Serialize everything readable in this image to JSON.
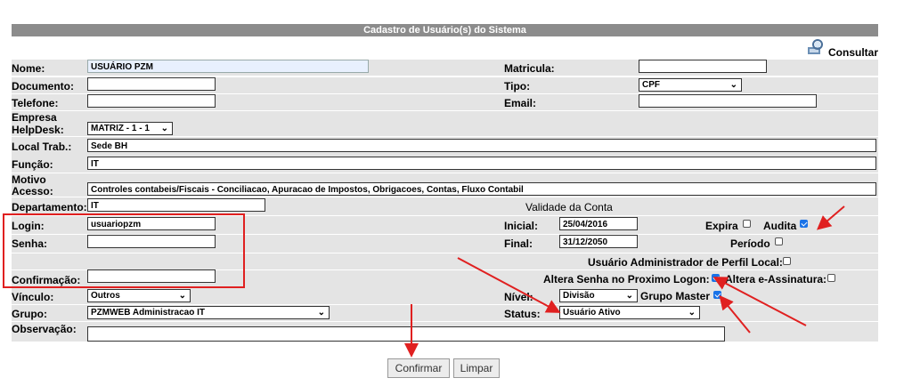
{
  "header": {
    "title": "Cadastro de Usuário(s) do Sistema",
    "consultar_label": "Consultar"
  },
  "fields": {
    "nome": {
      "label": "Nome:",
      "value": "USUÁRIO PZM"
    },
    "matricula": {
      "label": "Matricula:",
      "value": ""
    },
    "documento": {
      "label": "Documento:",
      "value": ""
    },
    "tipo": {
      "label": "Tipo:",
      "value": "CPF"
    },
    "telefone": {
      "label": "Telefone:",
      "value": ""
    },
    "email": {
      "label": "Email:",
      "value": ""
    },
    "empresa": {
      "label_line1": "Empresa",
      "label_line2": "HelpDesk:",
      "value": "MATRIZ - 1 - 1"
    },
    "local": {
      "label": "Local Trab.:",
      "value": "Sede BH"
    },
    "funcao": {
      "label": "Função:",
      "value": "IT"
    },
    "motivo": {
      "label_line1": "Motivo",
      "label_line2": "Acesso:",
      "value": "Controles contabeis/Fiscais - Conciliacao, Apuracao de Impostos, Obrigacoes, Contas, Fluxo Contabil"
    },
    "departamento": {
      "label": "Departamento:",
      "value": "IT"
    },
    "login": {
      "label": "Login:",
      "value": "usuariopzm"
    },
    "senha": {
      "label": "Senha:",
      "value": ""
    },
    "confirmacao": {
      "label": "Confirmação:",
      "value": ""
    },
    "vinculo": {
      "label": "Vínculo:",
      "value": "Outros"
    },
    "grupo": {
      "label": "Grupo:",
      "value": "PZMWEB Administracao IT"
    },
    "observacao": {
      "label": "Observação:",
      "value": ""
    },
    "nivel": {
      "label": "Nível:",
      "value": "Divisão"
    },
    "status": {
      "label": "Status:",
      "value": "Usuário Ativo"
    }
  },
  "validade": {
    "title": "Validade da Conta",
    "inicial_label": "Inicial:",
    "inicial_value": "25/04/2016",
    "final_label": "Final:",
    "final_value": "31/12/2050"
  },
  "checks": {
    "expira": {
      "label": "Expira",
      "checked": false
    },
    "audita": {
      "label": "Audita",
      "checked": true
    },
    "periodo": {
      "label": "Período",
      "checked": false
    },
    "admin_perfil": {
      "label": "Usuário Administrador de Perfil Local:",
      "checked": false
    },
    "altera_senha": {
      "label": "Altera Senha no Proximo Logon:",
      "checked": true
    },
    "altera_assinatura": {
      "label": "Altera e-Assinatura:",
      "checked": false
    },
    "grupo_master": {
      "label": "Grupo Master",
      "checked": true
    }
  },
  "buttons": {
    "confirmar": "Confirmar",
    "limpar": "Limpar"
  },
  "colors": {
    "annotation": "#e02020",
    "header_bg": "#8c8c8c",
    "row_bg": "#e4e4e4"
  }
}
